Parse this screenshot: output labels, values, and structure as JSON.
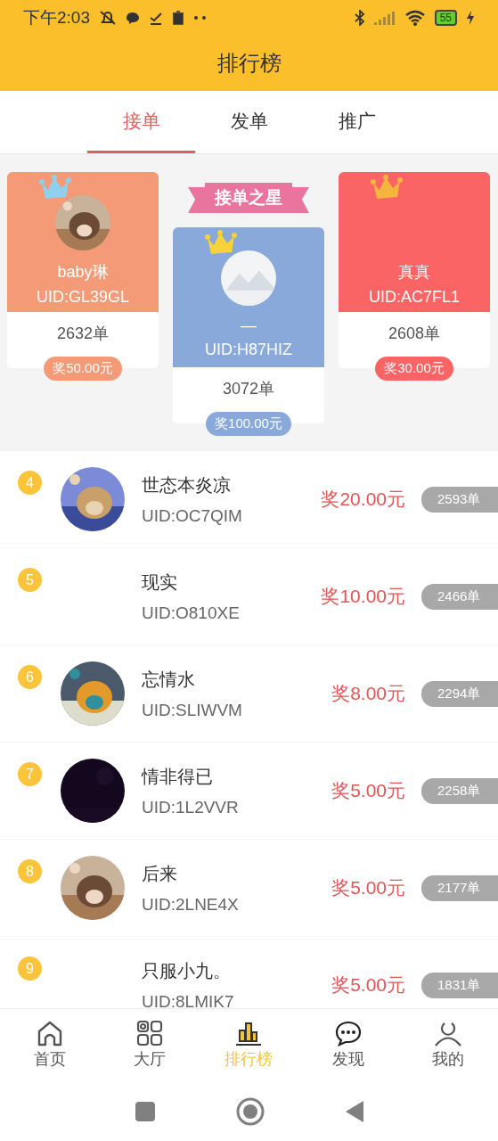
{
  "status_bar": {
    "time": "下午2:03",
    "battery": "55"
  },
  "title": "排行榜",
  "tabs": [
    {
      "label": "接单",
      "selected": true
    },
    {
      "label": "发单",
      "selected": false
    },
    {
      "label": "推广",
      "selected": false
    }
  ],
  "banner": "接单之星",
  "podium": [
    {
      "color": "#f49a76",
      "name": "baby琳",
      "uid": "UID:GL39GL",
      "count": "2632单",
      "reward": "奖50.00元"
    },
    {
      "color": "#88a9d9",
      "kind": "placeholder",
      "name": "—",
      "uid": "UID:H87HIZ",
      "count": "3072单",
      "reward": "奖100.00元"
    },
    {
      "color": "#fa6464",
      "kind": "none",
      "name": "真真",
      "uid": "UID:AC7FL1",
      "count": "2608单",
      "reward": "奖30.00元"
    }
  ],
  "list": [
    {
      "rank": "4",
      "name": "世态本炎凉",
      "uid": "UID:OC7QIM",
      "reward": "奖20.00元",
      "count": "2593单"
    },
    {
      "rank": "5",
      "kind": "none",
      "name": "现实",
      "uid": "UID:O810XE",
      "reward": "奖10.00元",
      "count": "2466单"
    },
    {
      "rank": "6",
      "name": "忘情水",
      "uid": "UID:SLIWVM",
      "reward": "奖8.00元",
      "count": "2294单"
    },
    {
      "rank": "7",
      "kind": "dark",
      "name": "情非得已",
      "uid": "UID:1L2VVR",
      "reward": "奖5.00元",
      "count": "2258单"
    },
    {
      "rank": "8",
      "name": "后来",
      "uid": "UID:2LNE4X",
      "reward": "奖5.00元",
      "count": "2177单"
    },
    {
      "rank": "9",
      "kind": "none",
      "name": "只服小九。",
      "uid": "UID:8LMIK7",
      "reward": "奖5.00元",
      "count": "1831单"
    }
  ],
  "nav": [
    {
      "label": "首页",
      "selected": false
    },
    {
      "label": "大厅",
      "selected": false
    },
    {
      "label": "排行榜",
      "selected": true
    },
    {
      "label": "发现",
      "selected": false
    },
    {
      "label": "我的",
      "selected": false
    }
  ]
}
